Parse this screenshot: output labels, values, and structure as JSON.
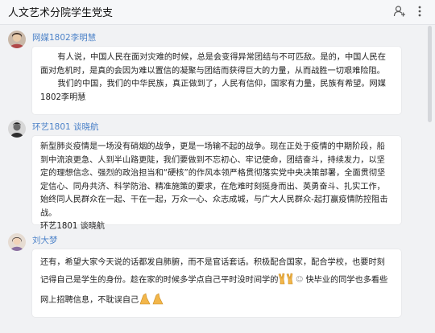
{
  "header": {
    "title": "人文艺术分院学生党支",
    "icons": [
      "add-user-icon",
      "more-icon"
    ]
  },
  "messages": [
    {
      "sender": "网媒1802李明慧",
      "avatar": "avatar-woman-photo",
      "paragraphs": [
        "有人说，中国人民在面对灾难的时候，总是会变得异常团结与不可匹敌。是的，中国人民在面对危机时，是真的会因为难以置信的凝聚与团结而获得巨大的力量，从而战胜一切艰难险阻。",
        "我们的中国，我们的中华民族，真正做到了，人民有信仰，国家有力量，民族有希望。网媒1802李明慧"
      ]
    },
    {
      "sender": "环艺1801 谈晓航",
      "avatar": "avatar-man-photo",
      "paragraphs": [
        "新型肺炎疫情是一场没有硝烟的战争，更是一场输不起的战争。现在正处于疫情的中期阶段，船到中流浪更急、人到半山路更陡，我们要做到不忘初心、牢记使命，团结奋斗，持续发力，以坚定的理想信念、强烈的政治担当和“硬核”的作风本领严格贯彻落实党中央决策部署，全面贯彻坚定信心、同舟共济、科学防治、精准施策的要求，在危难时刻挺身而出、英勇奋斗、扎实工作，始终同人民群众在一起、干在一起，万众一心、众志成城，与广大人民群众-起打赢疫情防控阻击战。",
        "环艺1801 谈晓航"
      ]
    },
    {
      "sender": "刘大梦",
      "avatar": "avatar-girl-photo",
      "text_part1": "还有，希望大家今天说的话都发自肺腑，而不是官话套话。积极配合国家，配合学校，也要时刻记得自己是学生的身份。趁在家的时候多学点自己平时没时间学的",
      "emoji1": "victory-hands-emoji",
      "text_part2": "快毕业的同学也多看些网上招聘信息，不耽误自己",
      "emoji2": "praying-hands-emoji"
    }
  ],
  "colors": {
    "sender_name": "#4c82c8",
    "bubble_bg": "#ffffff",
    "page_bg": "#f1f2f4"
  }
}
